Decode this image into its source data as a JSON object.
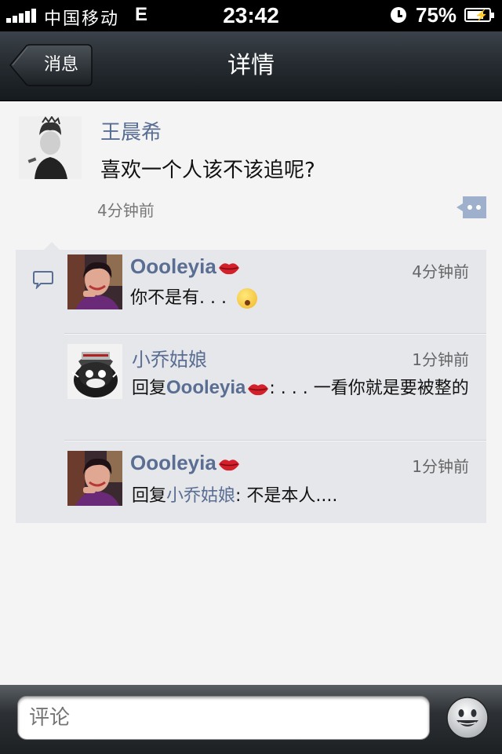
{
  "status_bar": {
    "carrier": "中国移动",
    "network": "E",
    "time": "23:42",
    "battery_percent": "75%",
    "battery_level": 0.75,
    "signal_bars": 5,
    "icons": [
      "signal-icon",
      "alarm-icon",
      "battery-charging-icon"
    ]
  },
  "nav": {
    "back_label": "消息",
    "title": "详情"
  },
  "post": {
    "author": "王晨希",
    "text": "喜欢一个人该不该追呢?",
    "time": "4分钟前",
    "more_icon": "more-icon"
  },
  "comments": [
    {
      "author": "Oooleyia",
      "badge_icon": "lips-icon",
      "time": "4分钟前",
      "text": "你不是有. . . ",
      "trailing_icon": "shocked-emoji-icon"
    },
    {
      "author": "小乔姑娘",
      "time": "1分钟前",
      "reply_prefix": "回复",
      "reply_to": "Oooleyia",
      "reply_to_badge": "lips-icon",
      "text": ": . . .  一看你就是要被整的"
    },
    {
      "author": "Oooleyia",
      "badge_icon": "lips-icon",
      "time": "1分钟前",
      "reply_prefix": "回复",
      "reply_to": "小乔姑娘",
      "text": ": 不是本人...."
    }
  ],
  "composer": {
    "placeholder": "评论",
    "emoji_icon": "smiley-icon"
  },
  "colors": {
    "link": "#5a6e93",
    "panel": "#e6e7ea",
    "background": "#f4f4f4"
  }
}
